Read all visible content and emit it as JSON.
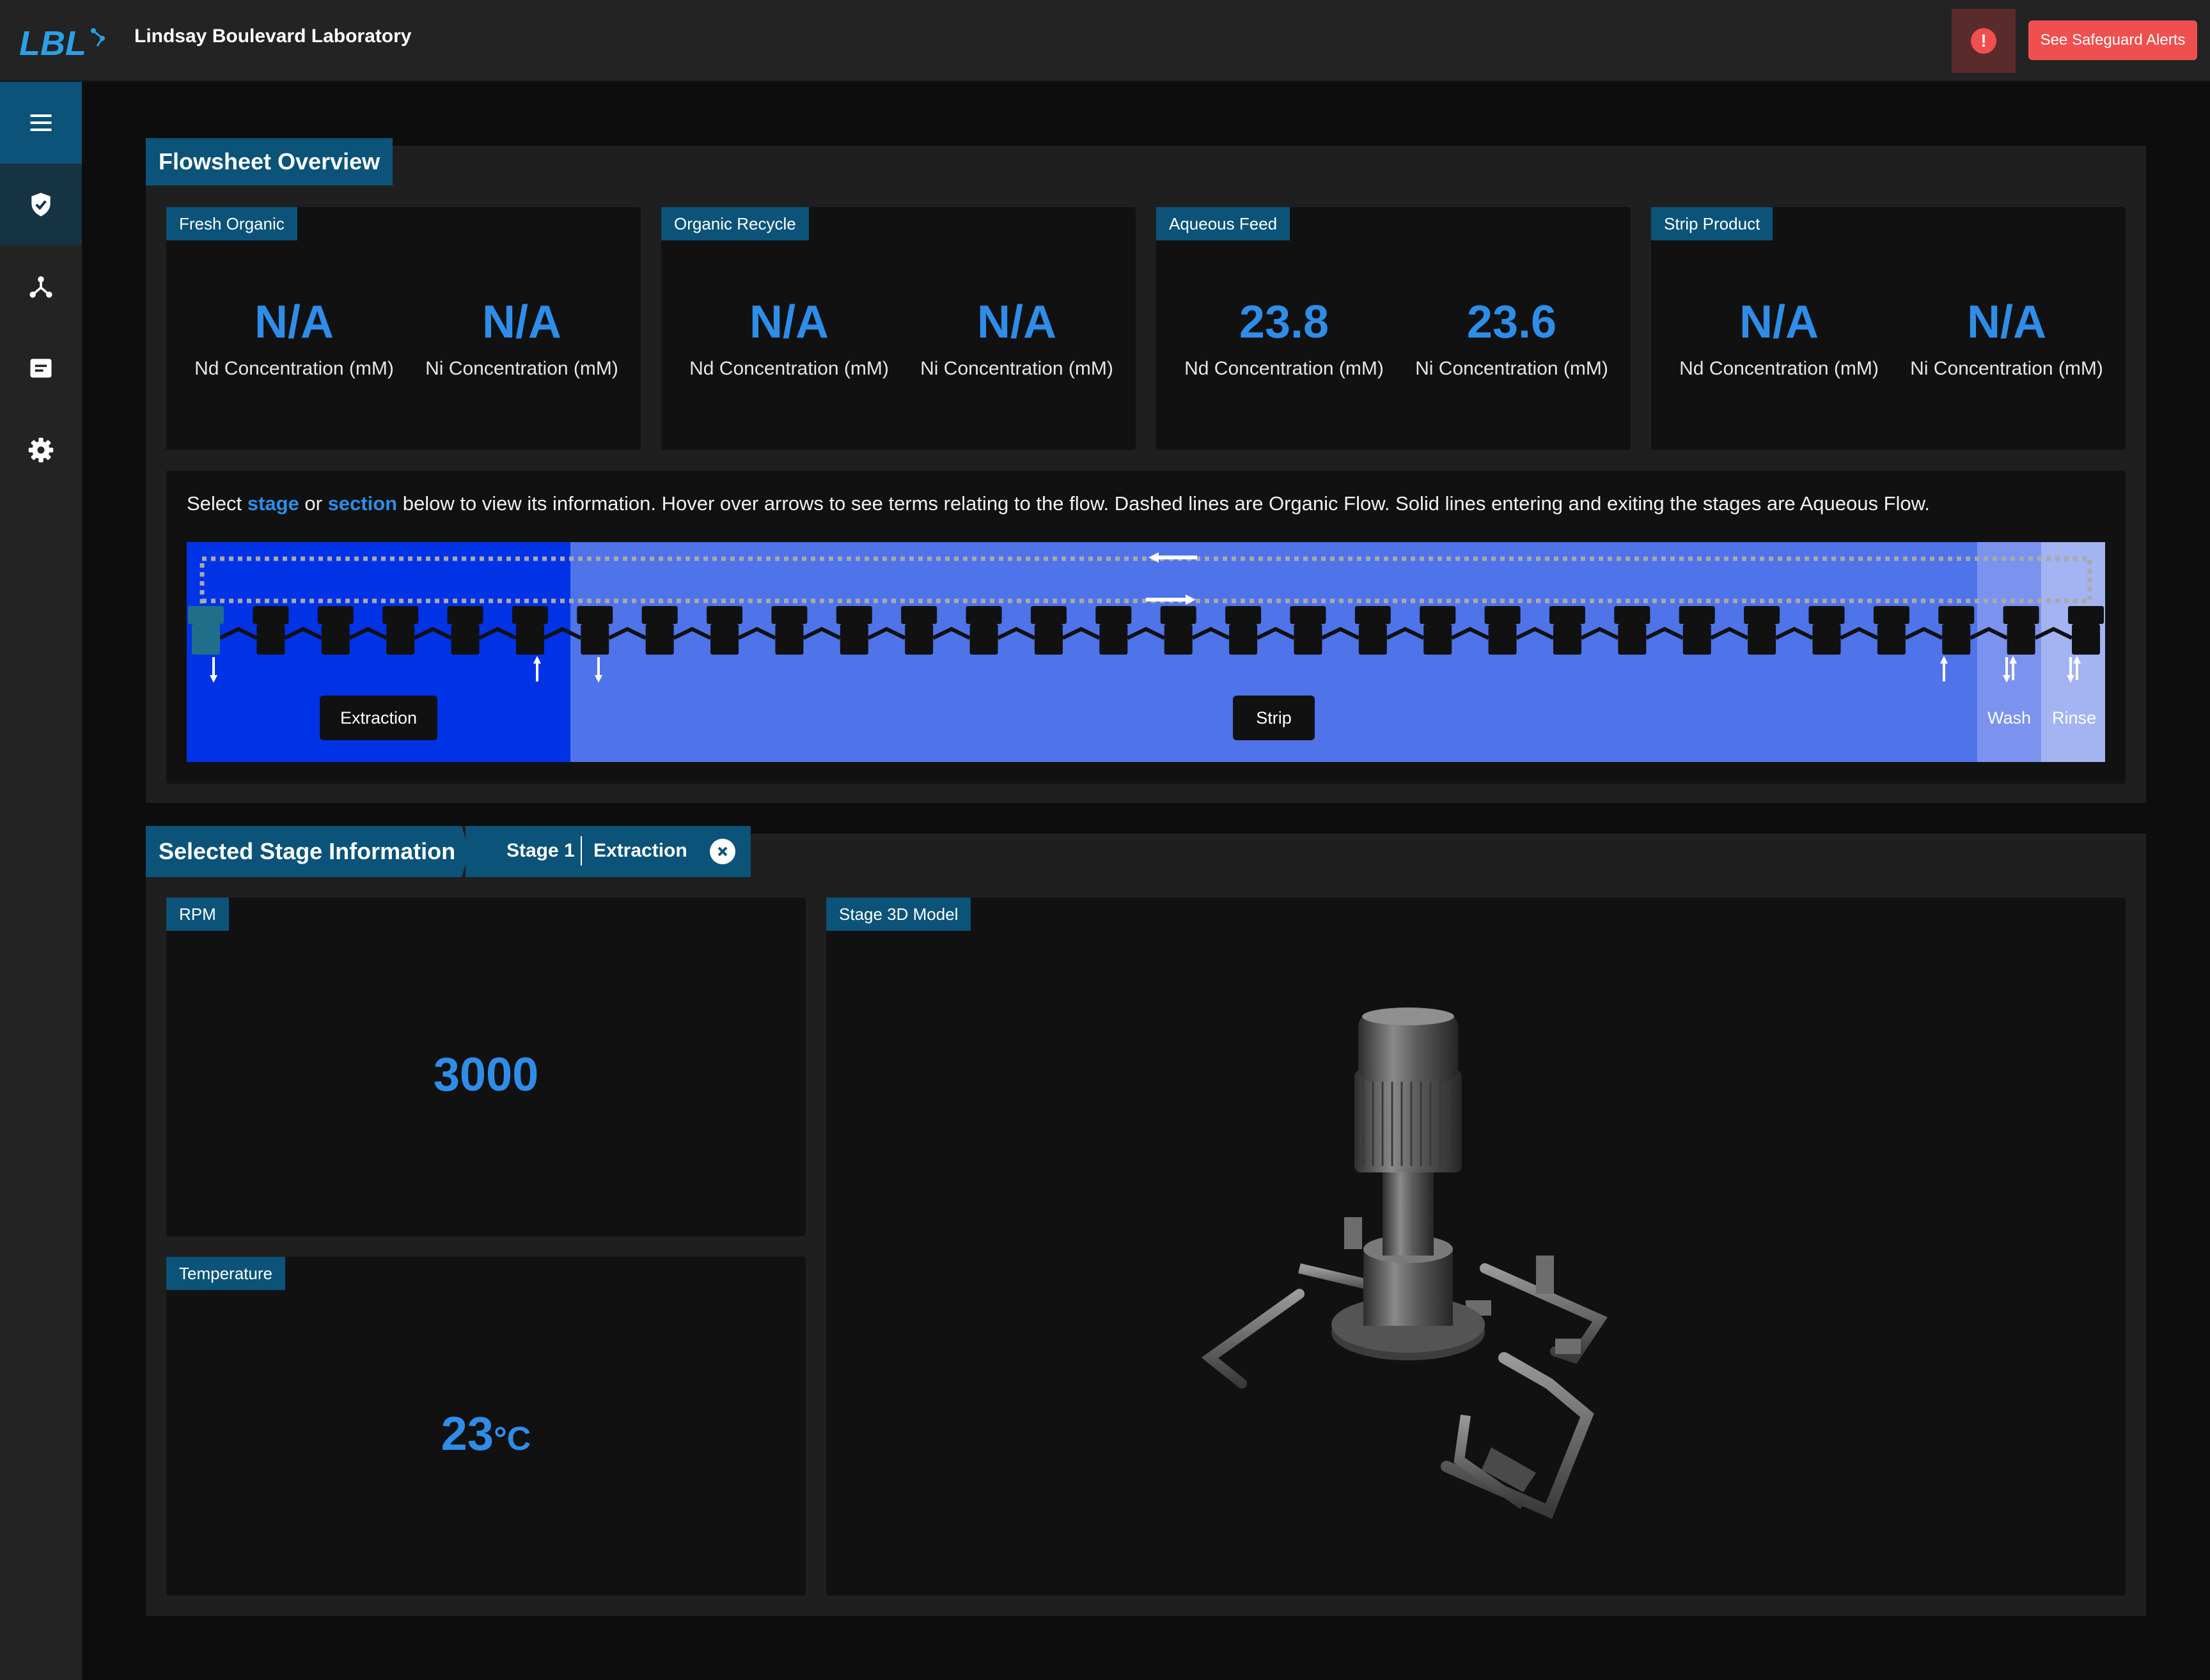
{
  "header": {
    "logo_text": "LBL",
    "title": "Lindsay Boulevard Laboratory",
    "alert_icon": "exclamation-icon",
    "alert_button_label": "See Safeguard Alerts",
    "colors": {
      "accent": "#0b5378",
      "value": "#2e8de8",
      "alert": "#ef4f4f"
    }
  },
  "sidebar": {
    "items": [
      {
        "name": "menu",
        "icon": "hamburger-icon"
      },
      {
        "name": "safeguards",
        "icon": "shield-check-icon",
        "active": true
      },
      {
        "name": "network",
        "icon": "network-icon"
      },
      {
        "name": "documents",
        "icon": "document-icon"
      },
      {
        "name": "settings",
        "icon": "gear-icon"
      }
    ]
  },
  "flowsheet": {
    "title": "Flowsheet Overview",
    "cards": [
      {
        "label": "Fresh Organic",
        "nd_value": "N/A",
        "nd_label": "Nd Concentration (mM)",
        "ni_value": "N/A",
        "ni_label": "Ni Concentration (mM)"
      },
      {
        "label": "Organic Recycle",
        "nd_value": "N/A",
        "nd_label": "Nd Concentration (mM)",
        "ni_value": "N/A",
        "ni_label": "Ni Concentration (mM)"
      },
      {
        "label": "Aqueous Feed",
        "nd_value": "23.8",
        "nd_label": "Nd Concentration (mM)",
        "ni_value": "23.6",
        "ni_label": "Ni Concentration (mM)"
      },
      {
        "label": "Strip Product",
        "nd_value": "N/A",
        "nd_label": "Nd Concentration (mM)",
        "ni_value": "N/A",
        "ni_label": "Ni Concentration (mM)"
      }
    ],
    "instructions": {
      "part1": "Select ",
      "stage_link": "stage",
      "part2": " or ",
      "section_link": "section",
      "part3": " below to view its information. Hover over arrows to see terms relating to the flow. Dashed lines are Organic Flow. Solid lines entering and exiting the stages are Aqueous Flow."
    },
    "sections": [
      {
        "label": "Extraction",
        "color": "#0033e6",
        "stages": 6
      },
      {
        "label": "Strip",
        "color": "#4f73e8",
        "stages": 22
      },
      {
        "label": "Wash",
        "color": "#7b93ef",
        "stages": 1
      },
      {
        "label": "Rinse",
        "color": "#a4b3f2",
        "stages": 1
      }
    ]
  },
  "selected_stage": {
    "title": "Selected Stage Information",
    "stage": "Stage 1",
    "section": "Extraction",
    "close_icon": "close-circle-icon",
    "rpm": {
      "label": "RPM",
      "value": "3000"
    },
    "temperature": {
      "label": "Temperature",
      "value": "23",
      "unit": "°C"
    },
    "model": {
      "label": "Stage 3D Model"
    }
  }
}
